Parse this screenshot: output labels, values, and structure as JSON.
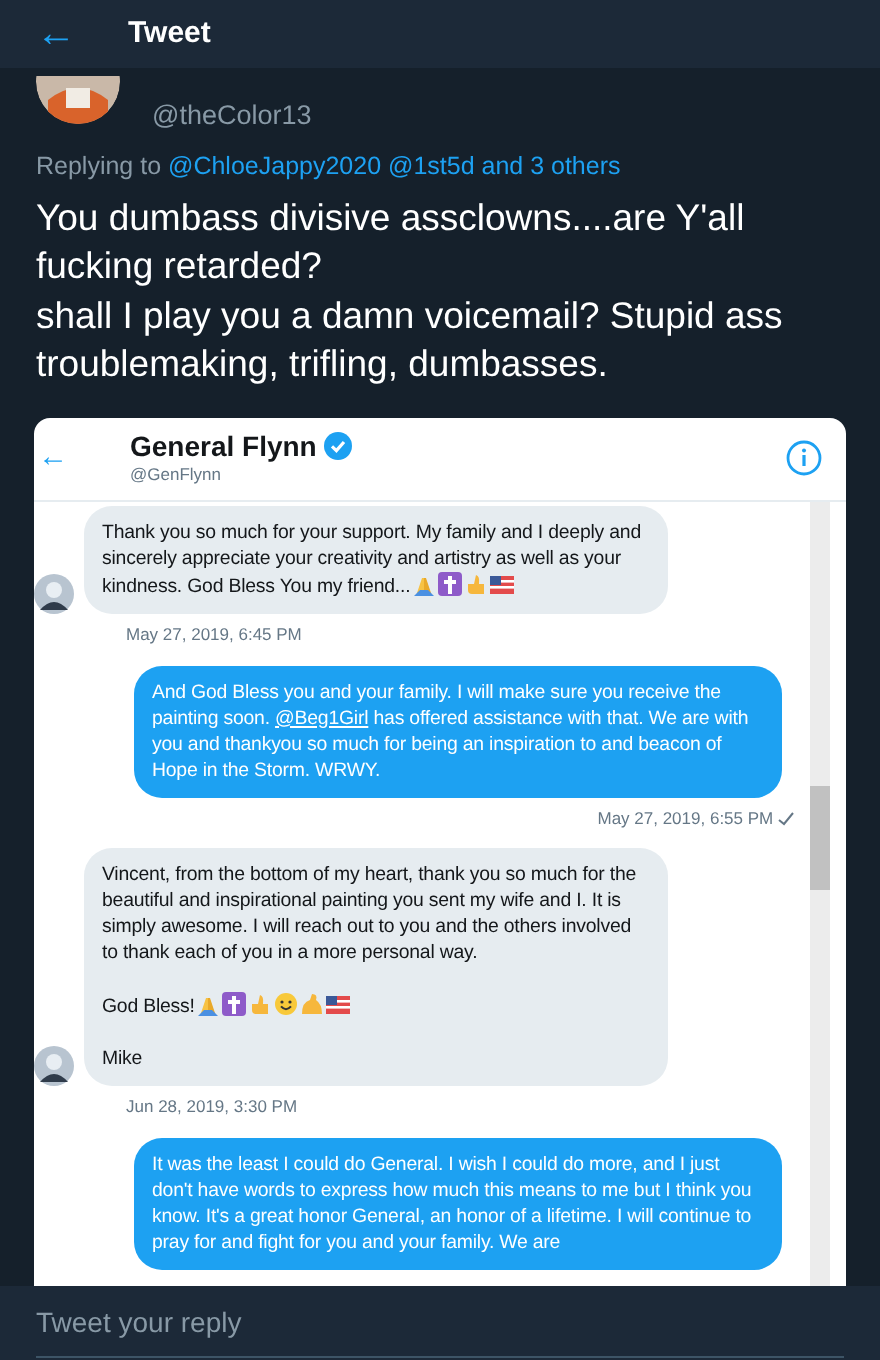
{
  "header": {
    "back": "←",
    "title": "Tweet"
  },
  "tweet": {
    "handle": "@theColor13",
    "replying_prefix": "Replying to",
    "replying_to": "@ChloeJappy2020 @1st5d and 3 others",
    "paragraphs": [
      "You dumbass divisive assclowns....are Y'all fucking retarded?",
      "shall I play you a damn voicemail? Stupid ass troublemaking, trifling, dumbasses."
    ]
  },
  "dm_screenshot": {
    "back": "←",
    "name": "General Flynn",
    "verified": true,
    "handle": "@GenFlynn",
    "messages": [
      {
        "kind": "incoming",
        "paragraphs": [
          {
            "parts": [
              {
                "kind": "text",
                "text": "Thank you so much for your support. My family and I deeply and sincerely appreciate your creativity and artistry as well as your kindness. God Bless You my friend..."
              }
            ],
            "emojis": [
              {
                "kind": "pray"
              },
              {
                "kind": "cross"
              },
              {
                "kind": "thumb"
              },
              {
                "kind": "flag"
              }
            ]
          }
        ],
        "time": "May 27, 2019, 6:45 PM"
      },
      {
        "kind": "outgoing",
        "paragraphs": [
          {
            "parts": [
              {
                "kind": "text",
                "text": "And God Bless you and your family. I will make sure you receive the painting soon. "
              },
              {
                "kind": "mention",
                "text": "@Beg1Girl"
              },
              {
                "kind": "text",
                "text": " has offered assistance with that. We are with you and thankyou so much for being an inspiration to and beacon of Hope in the Storm. WRWY."
              }
            ]
          }
        ],
        "time": "May 27, 2019, 6:55 PM",
        "read": true
      },
      {
        "kind": "incoming",
        "paragraphs": [
          {
            "parts": [
              {
                "kind": "text",
                "text": "Vincent, from the bottom of my heart, thank you so much for the beautiful and inspirational painting you sent my wife and I. It is simply awesome. I will reach out to you and the others involved to thank each of you in a more personal way."
              }
            ]
          },
          {
            "parts": [
              {
                "kind": "text",
                "text": "God Bless!"
              }
            ],
            "emojis": [
              {
                "kind": "pray"
              },
              {
                "kind": "cross"
              },
              {
                "kind": "thumb"
              },
              {
                "kind": "smile"
              },
              {
                "kind": "muscle"
              },
              {
                "kind": "flag"
              }
            ]
          },
          {
            "parts": [
              {
                "kind": "text",
                "text": "Mike"
              }
            ]
          }
        ],
        "time": "Jun 28, 2019, 3:30 PM"
      },
      {
        "kind": "outgoing",
        "paragraphs": [
          {
            "parts": [
              {
                "kind": "text",
                "text": "It was the least I could do General. I wish I could do more, and I just don't have words to express how much this means to me but I think you know. It's a great honor General, an honor of a lifetime. I will continue to pray for and fight for you and your family. We are"
              }
            ]
          }
        ]
      }
    ]
  },
  "reply": {
    "placeholder": "Tweet your reply"
  }
}
